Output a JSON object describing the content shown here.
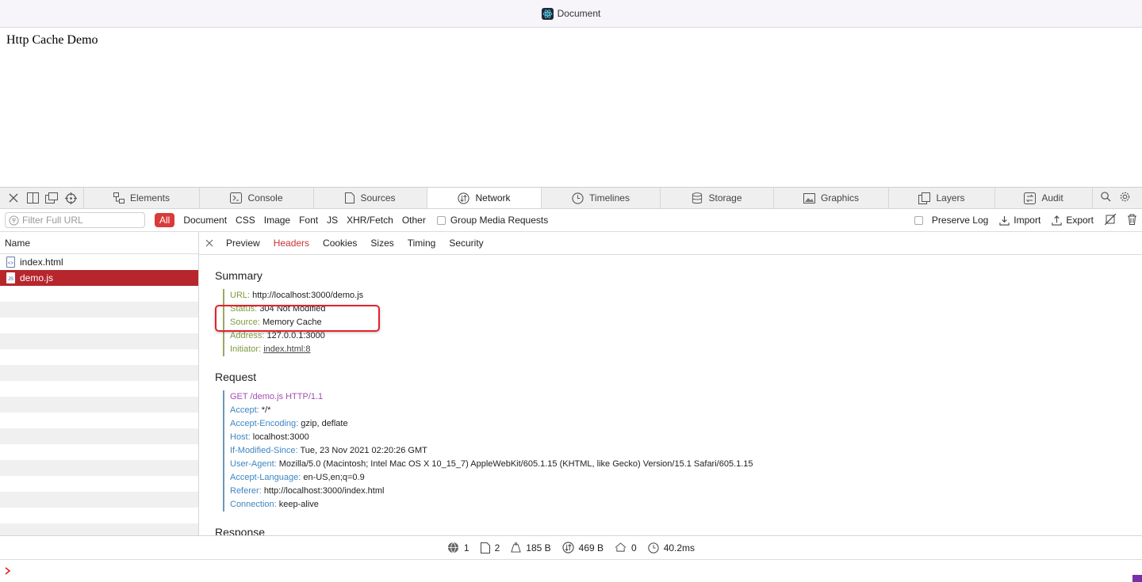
{
  "window": {
    "title": "Document"
  },
  "page": {
    "heading": "Http Cache Demo"
  },
  "devtools": {
    "tabs": [
      {
        "label": "Elements",
        "icon": "elements-icon"
      },
      {
        "label": "Console",
        "icon": "console-icon"
      },
      {
        "label": "Sources",
        "icon": "sources-icon"
      },
      {
        "label": "Network",
        "icon": "network-icon",
        "active": true
      },
      {
        "label": "Timelines",
        "icon": "timelines-icon"
      },
      {
        "label": "Storage",
        "icon": "storage-icon"
      },
      {
        "label": "Graphics",
        "icon": "graphics-icon"
      },
      {
        "label": "Layers",
        "icon": "layers-icon"
      },
      {
        "label": "Audit",
        "icon": "audit-icon"
      }
    ]
  },
  "filter": {
    "placeholder": "Filter Full URL",
    "types": [
      "All",
      "Document",
      "CSS",
      "Image",
      "Font",
      "JS",
      "XHR/Fetch",
      "Other"
    ],
    "group_media": "Group Media Requests",
    "preserve_log": "Preserve Log",
    "import_label": "Import",
    "export_label": "Export"
  },
  "list": {
    "header": "Name",
    "items": [
      "index.html",
      "demo.js"
    ]
  },
  "detail": {
    "tabs": [
      "Preview",
      "Headers",
      "Cookies",
      "Sizes",
      "Timing",
      "Security"
    ],
    "summary": {
      "title": "Summary",
      "url_key": "URL:",
      "url_val": "http://localhost:3000/demo.js",
      "status_key": "Status:",
      "status_val": "304 Not Modified",
      "source_key": "Source:",
      "source_val": "Memory Cache",
      "address_key": "Address:",
      "address_val": "127.0.0.1:3000",
      "initiator_key": "Initiator:",
      "initiator_val": "index.html:8"
    },
    "request": {
      "title": "Request",
      "line": "GET /demo.js HTTP/1.1",
      "headers": [
        {
          "k": "Accept:",
          "v": "*/*"
        },
        {
          "k": "Accept-Encoding:",
          "v": "gzip, deflate"
        },
        {
          "k": "Host:",
          "v": "localhost:3000"
        },
        {
          "k": "If-Modified-Since:",
          "v": "Tue, 23 Nov 2021 02:20:26 GMT"
        },
        {
          "k": "User-Agent:",
          "v": "Mozilla/5.0 (Macintosh; Intel Mac OS X 10_15_7) AppleWebKit/605.1.15 (KHTML, like Gecko) Version/15.1 Safari/605.1.15"
        },
        {
          "k": "Accept-Language:",
          "v": "en-US,en;q=0.9"
        },
        {
          "k": "Referer:",
          "v": "http://localhost:3000/index.html"
        },
        {
          "k": "Connection:",
          "v": "keep-alive"
        }
      ]
    },
    "response_title": "Response"
  },
  "status": {
    "requests": "1",
    "resources": "2",
    "transferred": "185 B",
    "size": "469 B",
    "redirects": "0",
    "time": "40.2ms"
  }
}
